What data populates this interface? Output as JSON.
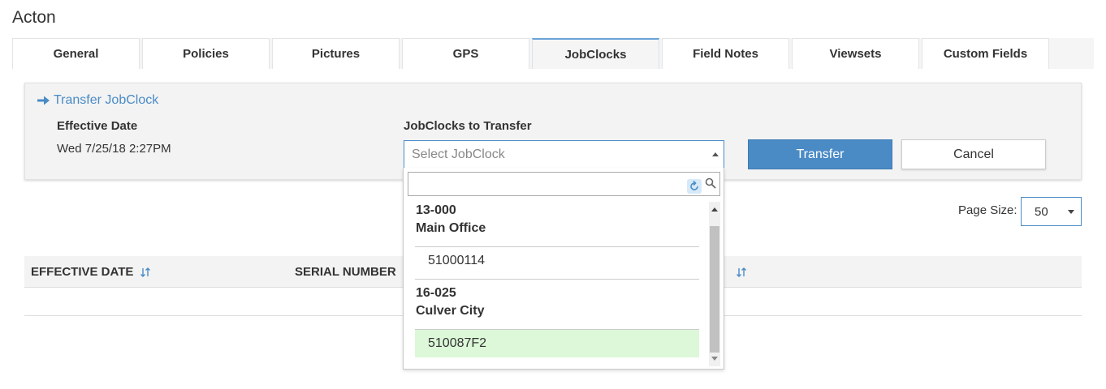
{
  "page": {
    "title": "Acton"
  },
  "tabs": [
    {
      "label": "General"
    },
    {
      "label": "Policies"
    },
    {
      "label": "Pictures"
    },
    {
      "label": "GPS"
    },
    {
      "label": "JobClocks"
    },
    {
      "label": "Field Notes"
    },
    {
      "label": "Viewsets"
    },
    {
      "label": "Custom Fields"
    }
  ],
  "active_tab": "JobClocks",
  "transfer": {
    "link_label": "Transfer JobClock",
    "effective_date_label": "Effective Date",
    "effective_date_value": "Wed 7/25/18 2:27PM",
    "jobclocks_label": "JobClocks to Transfer",
    "select_placeholder": "Select JobClock",
    "transfer_button": "Transfer",
    "cancel_button": "Cancel"
  },
  "dropdown": {
    "search_value": "",
    "groups": [
      {
        "code": "13-000",
        "name": "Main Office",
        "options": [
          "51000114"
        ]
      },
      {
        "code": "16-025",
        "name": "Culver City",
        "options": [
          "510087F2"
        ]
      }
    ],
    "highlighted_option": "510087F2"
  },
  "pagination": {
    "page_size_label": "Page Size:",
    "page_size_value": "50"
  },
  "table": {
    "columns": [
      {
        "label": "EFFECTIVE DATE"
      },
      {
        "label": "SERIAL NUMBER"
      }
    ]
  },
  "colors": {
    "accent": "#4a8bc6",
    "highlight": "#dcf8d8",
    "panel": "#f3f3f3"
  }
}
